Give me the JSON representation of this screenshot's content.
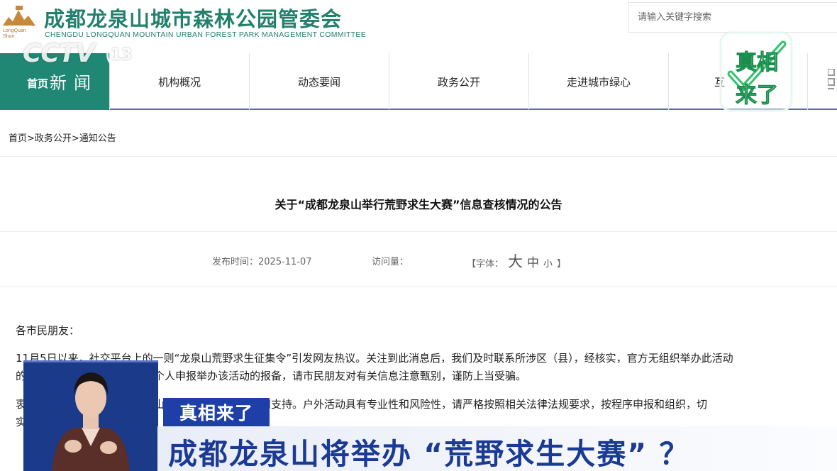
{
  "header": {
    "logo_text": "LongQuan Shan",
    "title": "成都龙泉山城市森林公园管委会",
    "subtitle": "CHENGDU LONGQUAN MOUNTAIN URBAN FOREST PARK MANAGEMENT COMMITTEE",
    "search_placeholder": "请输入关键字搜索"
  },
  "nav": {
    "home": "首页",
    "news_label": "新闻",
    "items": [
      "机构概况",
      "动态要闻",
      "政务公开",
      "走进城市绿心",
      "互"
    ]
  },
  "breadcrumb": "首页>政务公开>通知公告",
  "article": {
    "title": "关于“成都龙泉山举行荒野求生大赛”信息查核情况的公告",
    "publish_time": "发布时间：2025-11-07",
    "visits": "访问量：",
    "font_label": "【字体：",
    "font_big": "大",
    "font_mid": "中",
    "font_small": "小",
    "font_close": "】",
    "salutation": "各市民朋友：",
    "p1_line1": "11月5日以来，社交平台上的一则“龙泉山荒野求生征集令”引发网友热议。关注到此消息后，我们及时联系所涉区（县），经核实，官方无组织举办此活动",
    "p1_line2": "的计划，也未收到相关组织和个人申报举办该活动的报备，请市民朋友对有关信息注意甄别，谨防上当受骗。",
    "p2_line1": "衷心感谢广大市民朋友对龙泉山城市森林公园的关注和支持。户外活动具有专业性和风险性，请严格按照相关法律法规要求，按程序申报和组织，切",
    "p2_line2": "实"
  },
  "overlay": {
    "channel_logo": "CCTV",
    "channel_number": "13",
    "show_logo": "真相来了",
    "banner_tag": "真相来了",
    "banner_headline": "成都龙泉山将举办 “荒野求生大赛” ？"
  },
  "colors": {
    "brand_green": "#23806d",
    "nav_active": "#1f8774",
    "banner_blue": "#1e3fa8",
    "headline_blue": "#1a3a93"
  }
}
